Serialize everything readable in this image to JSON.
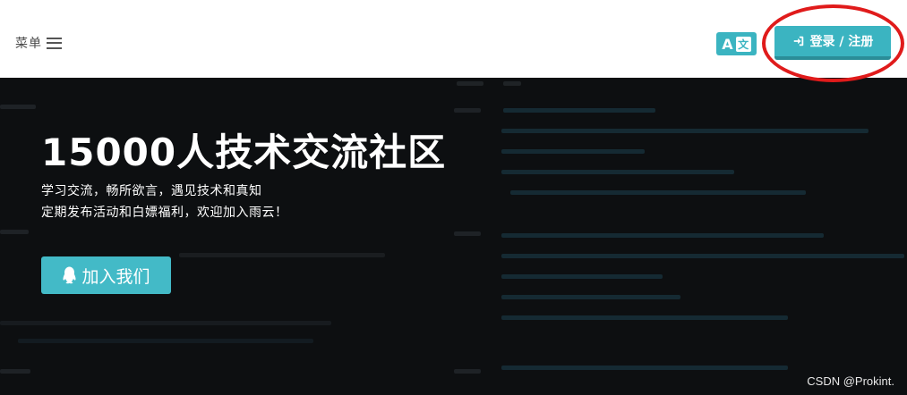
{
  "header": {
    "menu_label": "菜单",
    "lang_switch": {
      "latin": "A",
      "chinese": "文"
    },
    "login_label": "登录 / 注册"
  },
  "hero": {
    "title": "15000人技术交流社区",
    "subtitle_line1": "学习交流，畅所欲言，遇见技术和真知",
    "subtitle_line2": "定期发布活动和白嫖福利，欢迎加入雨云！",
    "join_button_label": "加入我们"
  },
  "watermark": "CSDN @Prokint.",
  "colors": {
    "accent": "#3bb4c1",
    "annotation": "#e01b1b",
    "hero_background": "#0d0f11"
  },
  "icons": [
    "hamburger-icon",
    "translate-icon",
    "sign-in-icon",
    "qq-icon"
  ]
}
